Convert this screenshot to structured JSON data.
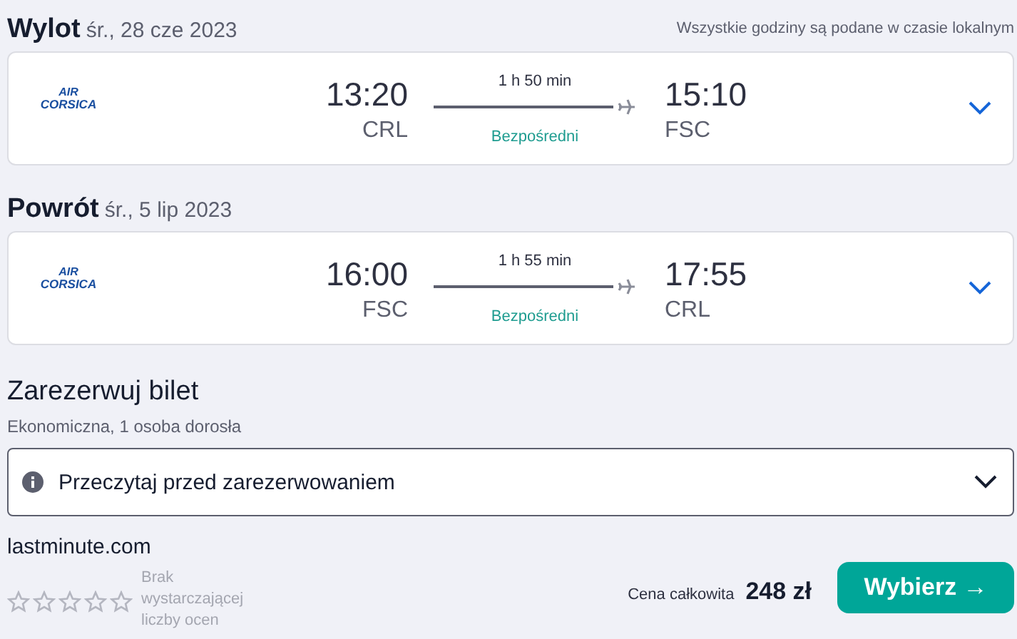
{
  "legs": [
    {
      "title": "Wylot",
      "date": "śr., 28 cze 2023",
      "note": "Wszystkie godziny są podane w czasie lokalnym",
      "airline": [
        "AIR",
        "CORSICA"
      ],
      "dep_time": "13:20",
      "dep_airport": "CRL",
      "duration": "1 h 50 min",
      "stops": "Bezpośredni",
      "arr_time": "15:10",
      "arr_airport": "FSC",
      "expanded": false
    },
    {
      "title": "Powrót",
      "date": "śr., 5 lip 2023",
      "airline": [
        "AIR",
        "CORSICA"
      ],
      "dep_time": "16:00",
      "dep_airport": "FSC",
      "duration": "1 h 55 min",
      "stops": "Bezpośredni",
      "arr_time": "17:55",
      "arr_airport": "CRL",
      "expanded": false
    }
  ],
  "booking": {
    "title": "Zarezerwuj bilet",
    "subtitle": "Ekonomiczna, 1 osoba dorosła",
    "notice": "Przeczytaj przed zarezerwowaniem",
    "notice_expanded": false,
    "provider": "lastminute.com",
    "stars": 0,
    "rating_text": "Brak wystarczającej liczby ocen",
    "price_label": "Cena całkowita",
    "price": "248 zł",
    "button": "Wybierz →"
  }
}
